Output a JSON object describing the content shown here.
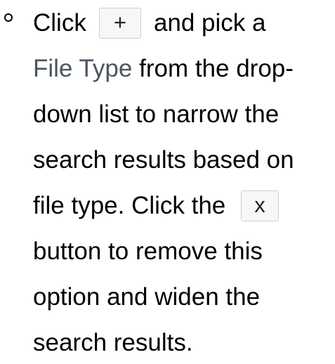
{
  "item": {
    "w_click": "Click",
    "add_button": "+",
    "w_and_pick": "and pick a",
    "file_type_term": "File Type",
    "w_from_drop": " from the drop-",
    "l3": "down list to narrow the",
    "l4": "search results based on",
    "w_file_type_click": "file type. Click the",
    "remove_button": "x",
    "l6": "button to remove this",
    "l7": "option and widen the",
    "l8": "search results."
  },
  "colors": {
    "text": "#000000",
    "term": "#4a5560",
    "button_bg": "#f7f7f7",
    "button_border": "#cfcfcf"
  }
}
